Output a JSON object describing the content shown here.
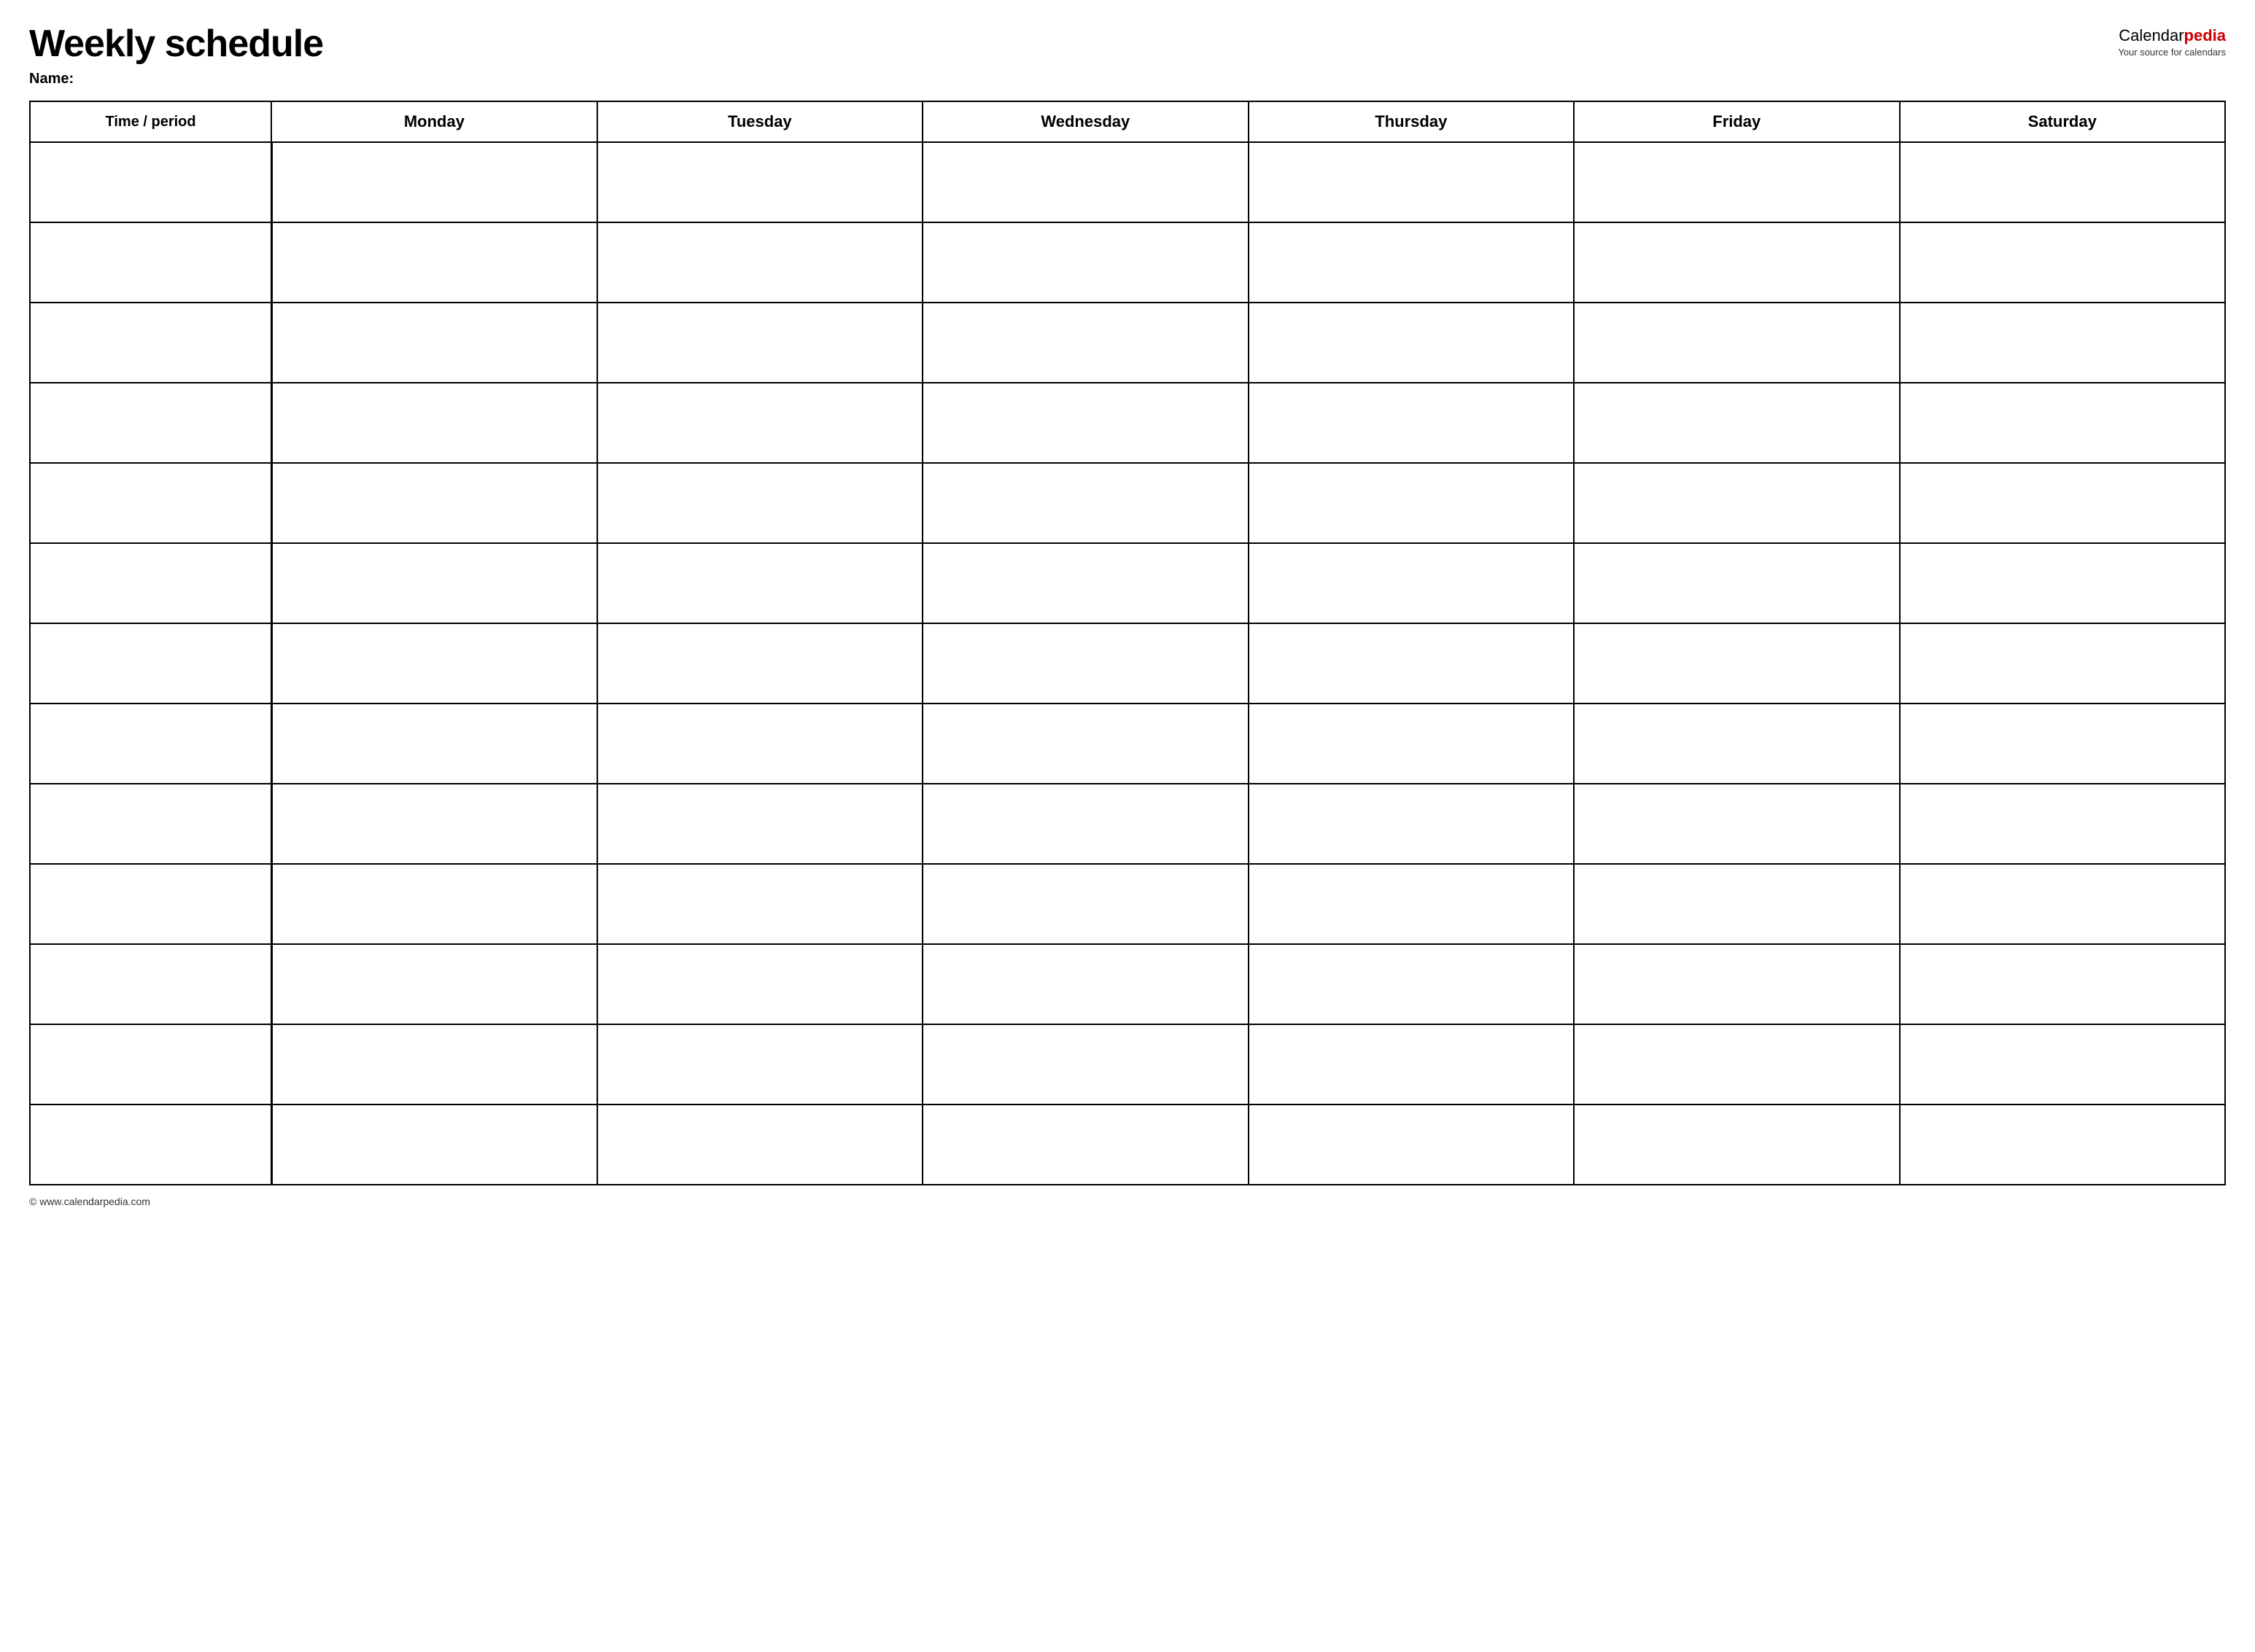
{
  "header": {
    "title": "Weekly schedule",
    "name_label": "Name:",
    "logo": {
      "part1": "Calendar",
      "part2": "pedia",
      "tagline": "Your source for calendars"
    }
  },
  "table": {
    "columns": [
      {
        "key": "time",
        "label": "Time / period"
      },
      {
        "key": "monday",
        "label": "Monday"
      },
      {
        "key": "tuesday",
        "label": "Tuesday"
      },
      {
        "key": "wednesday",
        "label": "Wednesday"
      },
      {
        "key": "thursday",
        "label": "Thursday"
      },
      {
        "key": "friday",
        "label": "Friday"
      },
      {
        "key": "saturday",
        "label": "Saturday"
      }
    ],
    "row_count": 13
  },
  "footer": {
    "url": "© www.calendarpedia.com"
  }
}
